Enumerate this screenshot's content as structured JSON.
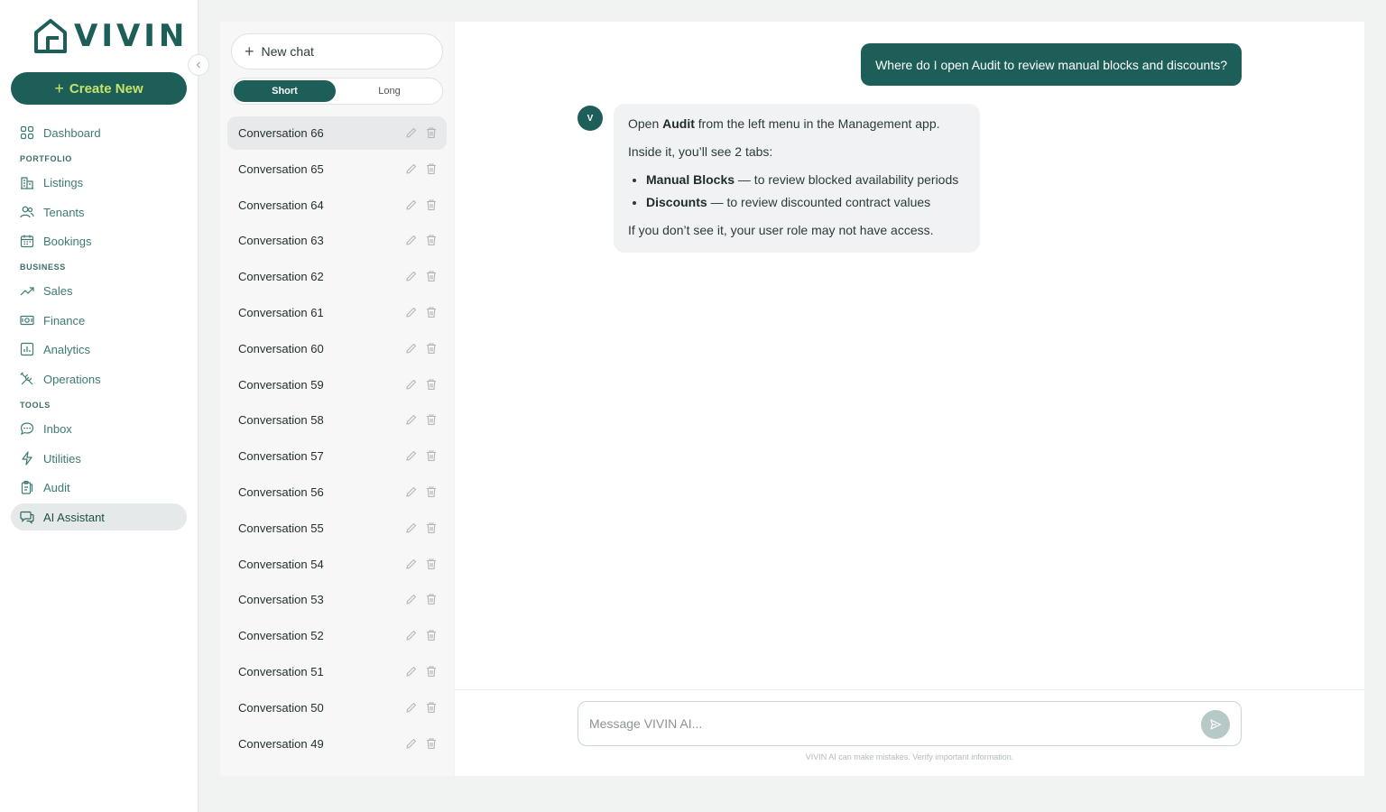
{
  "app": {
    "logo_text": "VIVIN",
    "brand_color": "#1d5f58",
    "accent_color": "#c6e36a"
  },
  "sidebar": {
    "create_label": "Create New",
    "items": [
      {
        "label": "Dashboard",
        "icon": "dashboard-icon"
      },
      {
        "section": "PORTFOLIO"
      },
      {
        "label": "Listings",
        "icon": "building-icon"
      },
      {
        "label": "Tenants",
        "icon": "users-icon"
      },
      {
        "label": "Bookings",
        "icon": "calendar-icon"
      },
      {
        "section": "BUSINESS"
      },
      {
        "label": "Sales",
        "icon": "trending-up-icon"
      },
      {
        "label": "Finance",
        "icon": "banknote-icon"
      },
      {
        "label": "Analytics",
        "icon": "chart-icon"
      },
      {
        "label": "Operations",
        "icon": "tools-icon"
      },
      {
        "section": "TOOLS"
      },
      {
        "label": "Inbox",
        "icon": "chat-bubble-icon"
      },
      {
        "label": "Utilities",
        "icon": "bolt-icon"
      },
      {
        "label": "Audit",
        "icon": "clipboard-icon"
      },
      {
        "label": "AI Assistant",
        "icon": "ai-chat-icon",
        "active": true
      }
    ]
  },
  "conversations": {
    "new_chat_label": "New chat",
    "toggle": {
      "short": "Short",
      "long": "Long",
      "selected": "Short"
    },
    "items": [
      "Conversation 66",
      "Conversation 65",
      "Conversation 64",
      "Conversation 63",
      "Conversation 62",
      "Conversation 61",
      "Conversation 60",
      "Conversation 59",
      "Conversation 58",
      "Conversation 57",
      "Conversation 56",
      "Conversation 55",
      "Conversation 54",
      "Conversation 53",
      "Conversation 52",
      "Conversation 51",
      "Conversation 50",
      "Conversation 49"
    ],
    "selected": "Conversation 66"
  },
  "chat": {
    "user_message": "Where do I open Audit to review manual blocks and discounts?",
    "assistant_avatar": "V",
    "assistant": {
      "p1_pre": "Open ",
      "p1_bold": "Audit",
      "p1_post": " from the left menu in the Management app.",
      "p2": "Inside it, you’ll see 2 tabs:",
      "bullets": [
        {
          "bold": "Manual Blocks",
          "text": " — to review blocked availability periods"
        },
        {
          "bold": "Discounts",
          "text": " — to review discounted contract values"
        }
      ],
      "p3": "If you don’t see it, your user role may not have access."
    },
    "composer_placeholder": "Message VIVIN AI...",
    "disclaimer": "VIVIN AI can make mistakes. Verify important information."
  }
}
